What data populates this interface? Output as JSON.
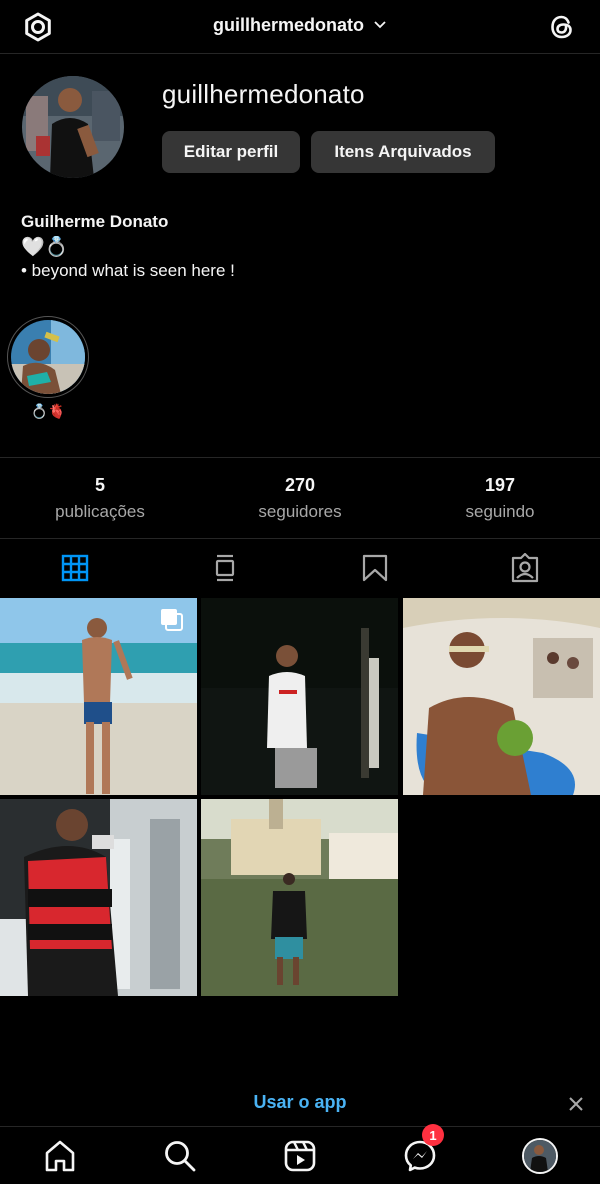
{
  "header": {
    "username": "guillhermedonato"
  },
  "profile": {
    "username": "guillhermedonato",
    "edit_label": "Editar perfil",
    "archive_label": "Itens Arquivados",
    "full_name": "Guilherme Donato",
    "bio_emoji": "🤍💍",
    "bio_line": "• beyond what is seen here !"
  },
  "highlights": [
    {
      "label": "💍🫀"
    }
  ],
  "stats": [
    {
      "value": "5",
      "label": "publicações"
    },
    {
      "value": "270",
      "label": "seguidores"
    },
    {
      "value": "197",
      "label": "seguindo"
    }
  ],
  "tabs": [
    "grid",
    "feed",
    "saved",
    "tagged"
  ],
  "banner": {
    "link_label": "Usar o app"
  },
  "nav": {
    "messages_badge": "1"
  },
  "colors": {
    "accent": "#4ab3f4",
    "active_tab": "#0095f6",
    "badge": "#ff3040"
  }
}
